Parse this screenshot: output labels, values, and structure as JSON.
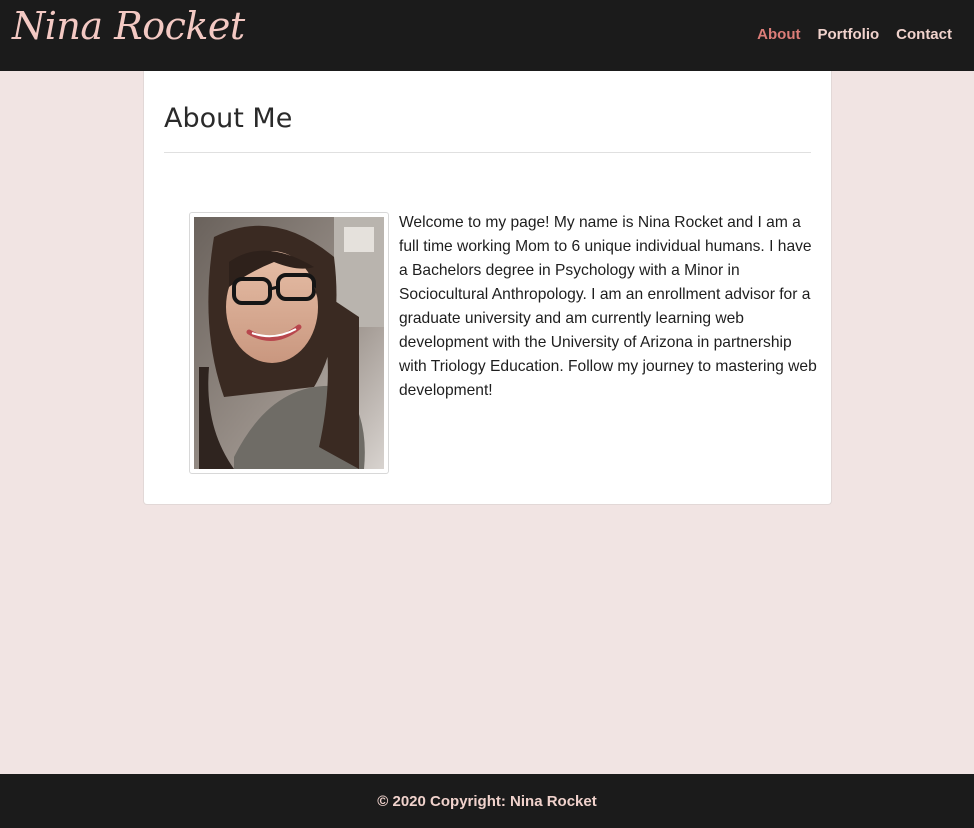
{
  "navbar": {
    "brand": "Nina Rocket",
    "links": [
      {
        "label": "About",
        "active": true
      },
      {
        "label": "Portfolio",
        "active": false
      },
      {
        "label": "Contact",
        "active": false
      }
    ]
  },
  "main": {
    "title": "About Me",
    "bio": "Welcome to my page! My name is Nina Rocket and I am a full time working Mom to 6 unique individual humans. I have a Bachelors degree in Psychology with a Minor in Sociocultural Anthropology. I am an enrollment advisor for a graduate university and am currently learning web development with the University of Arizona in partnership with Triology Education. Follow my journey to mastering web development!"
  },
  "footer": {
    "copyright": "© 2020 Copyright: Nina Rocket"
  },
  "colors": {
    "navbar_bg": "#1b1b1b",
    "page_bg": "#f1e4e3",
    "brand": "#f3c9c3",
    "nav_active": "#dc7d78",
    "nav_text": "#f0d2cc"
  }
}
